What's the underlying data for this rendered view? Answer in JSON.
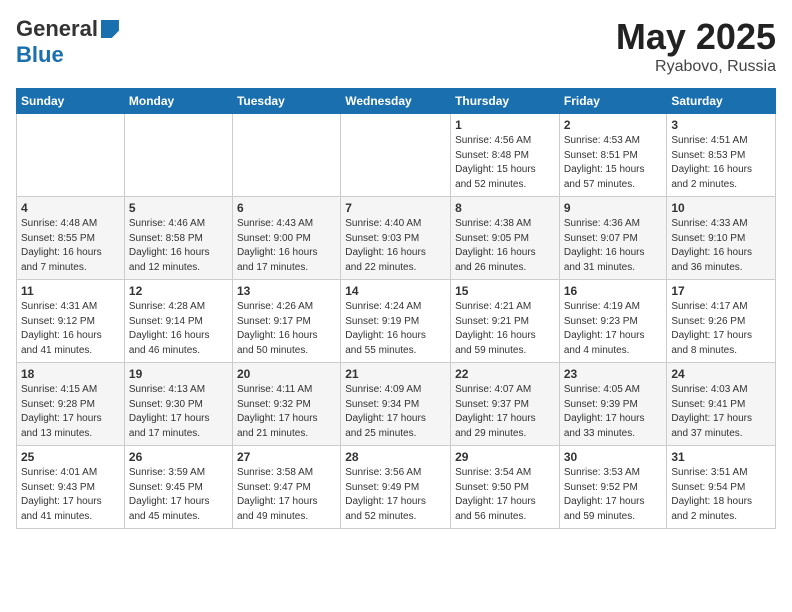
{
  "header": {
    "logo_general": "General",
    "logo_blue": "Blue",
    "title": "May 2025",
    "location": "Ryabovo, Russia"
  },
  "days_of_week": [
    "Sunday",
    "Monday",
    "Tuesday",
    "Wednesday",
    "Thursday",
    "Friday",
    "Saturday"
  ],
  "weeks": [
    [
      {
        "day": "",
        "info": ""
      },
      {
        "day": "",
        "info": ""
      },
      {
        "day": "",
        "info": ""
      },
      {
        "day": "",
        "info": ""
      },
      {
        "day": "1",
        "info": "Sunrise: 4:56 AM\nSunset: 8:48 PM\nDaylight: 15 hours\nand 52 minutes."
      },
      {
        "day": "2",
        "info": "Sunrise: 4:53 AM\nSunset: 8:51 PM\nDaylight: 15 hours\nand 57 minutes."
      },
      {
        "day": "3",
        "info": "Sunrise: 4:51 AM\nSunset: 8:53 PM\nDaylight: 16 hours\nand 2 minutes."
      }
    ],
    [
      {
        "day": "4",
        "info": "Sunrise: 4:48 AM\nSunset: 8:55 PM\nDaylight: 16 hours\nand 7 minutes."
      },
      {
        "day": "5",
        "info": "Sunrise: 4:46 AM\nSunset: 8:58 PM\nDaylight: 16 hours\nand 12 minutes."
      },
      {
        "day": "6",
        "info": "Sunrise: 4:43 AM\nSunset: 9:00 PM\nDaylight: 16 hours\nand 17 minutes."
      },
      {
        "day": "7",
        "info": "Sunrise: 4:40 AM\nSunset: 9:03 PM\nDaylight: 16 hours\nand 22 minutes."
      },
      {
        "day": "8",
        "info": "Sunrise: 4:38 AM\nSunset: 9:05 PM\nDaylight: 16 hours\nand 26 minutes."
      },
      {
        "day": "9",
        "info": "Sunrise: 4:36 AM\nSunset: 9:07 PM\nDaylight: 16 hours\nand 31 minutes."
      },
      {
        "day": "10",
        "info": "Sunrise: 4:33 AM\nSunset: 9:10 PM\nDaylight: 16 hours\nand 36 minutes."
      }
    ],
    [
      {
        "day": "11",
        "info": "Sunrise: 4:31 AM\nSunset: 9:12 PM\nDaylight: 16 hours\nand 41 minutes."
      },
      {
        "day": "12",
        "info": "Sunrise: 4:28 AM\nSunset: 9:14 PM\nDaylight: 16 hours\nand 46 minutes."
      },
      {
        "day": "13",
        "info": "Sunrise: 4:26 AM\nSunset: 9:17 PM\nDaylight: 16 hours\nand 50 minutes."
      },
      {
        "day": "14",
        "info": "Sunrise: 4:24 AM\nSunset: 9:19 PM\nDaylight: 16 hours\nand 55 minutes."
      },
      {
        "day": "15",
        "info": "Sunrise: 4:21 AM\nSunset: 9:21 PM\nDaylight: 16 hours\nand 59 minutes."
      },
      {
        "day": "16",
        "info": "Sunrise: 4:19 AM\nSunset: 9:23 PM\nDaylight: 17 hours\nand 4 minutes."
      },
      {
        "day": "17",
        "info": "Sunrise: 4:17 AM\nSunset: 9:26 PM\nDaylight: 17 hours\nand 8 minutes."
      }
    ],
    [
      {
        "day": "18",
        "info": "Sunrise: 4:15 AM\nSunset: 9:28 PM\nDaylight: 17 hours\nand 13 minutes."
      },
      {
        "day": "19",
        "info": "Sunrise: 4:13 AM\nSunset: 9:30 PM\nDaylight: 17 hours\nand 17 minutes."
      },
      {
        "day": "20",
        "info": "Sunrise: 4:11 AM\nSunset: 9:32 PM\nDaylight: 17 hours\nand 21 minutes."
      },
      {
        "day": "21",
        "info": "Sunrise: 4:09 AM\nSunset: 9:34 PM\nDaylight: 17 hours\nand 25 minutes."
      },
      {
        "day": "22",
        "info": "Sunrise: 4:07 AM\nSunset: 9:37 PM\nDaylight: 17 hours\nand 29 minutes."
      },
      {
        "day": "23",
        "info": "Sunrise: 4:05 AM\nSunset: 9:39 PM\nDaylight: 17 hours\nand 33 minutes."
      },
      {
        "day": "24",
        "info": "Sunrise: 4:03 AM\nSunset: 9:41 PM\nDaylight: 17 hours\nand 37 minutes."
      }
    ],
    [
      {
        "day": "25",
        "info": "Sunrise: 4:01 AM\nSunset: 9:43 PM\nDaylight: 17 hours\nand 41 minutes."
      },
      {
        "day": "26",
        "info": "Sunrise: 3:59 AM\nSunset: 9:45 PM\nDaylight: 17 hours\nand 45 minutes."
      },
      {
        "day": "27",
        "info": "Sunrise: 3:58 AM\nSunset: 9:47 PM\nDaylight: 17 hours\nand 49 minutes."
      },
      {
        "day": "28",
        "info": "Sunrise: 3:56 AM\nSunset: 9:49 PM\nDaylight: 17 hours\nand 52 minutes."
      },
      {
        "day": "29",
        "info": "Sunrise: 3:54 AM\nSunset: 9:50 PM\nDaylight: 17 hours\nand 56 minutes."
      },
      {
        "day": "30",
        "info": "Sunrise: 3:53 AM\nSunset: 9:52 PM\nDaylight: 17 hours\nand 59 minutes."
      },
      {
        "day": "31",
        "info": "Sunrise: 3:51 AM\nSunset: 9:54 PM\nDaylight: 18 hours\nand 2 minutes."
      }
    ]
  ]
}
